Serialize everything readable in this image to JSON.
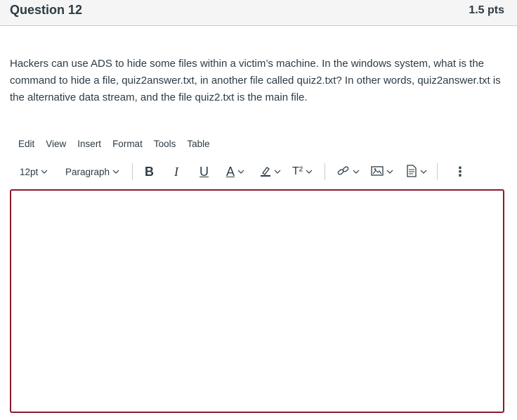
{
  "question": {
    "title": "Question 12",
    "points": "1.5 pts",
    "text": "Hackers can use ADS to hide some files within a victim’s machine.  In the windows system, what is the command to hide a file, quiz2answer.txt, in another file called quiz2.txt? In other words, quiz2answer.txt is the alternative data stream, and the file quiz2.txt is the main file."
  },
  "editor": {
    "menu": [
      "Edit",
      "View",
      "Insert",
      "Format",
      "Tools",
      "Table"
    ],
    "font_size": "12pt",
    "block_format": "Paragraph",
    "bold": "B",
    "italic": "I",
    "underline": "U",
    "text_color": "A",
    "superscript": "T²",
    "more": "⋮",
    "border_color": "#8b1a2c"
  }
}
